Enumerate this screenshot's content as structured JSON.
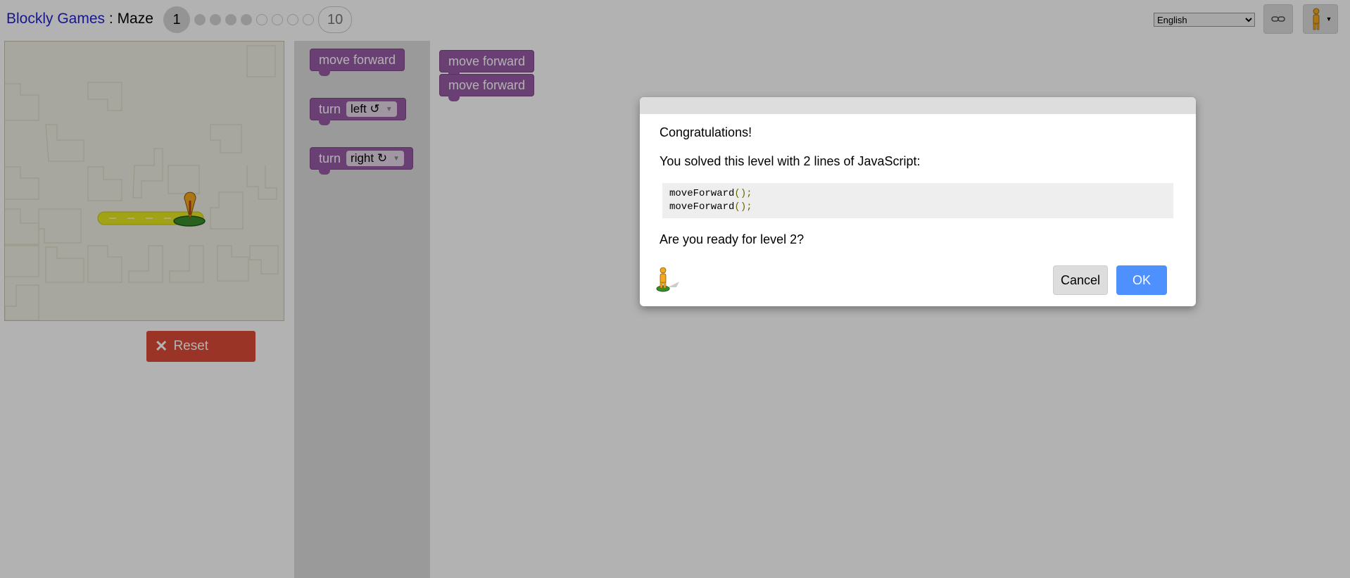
{
  "header": {
    "app_title": "Blockly Games",
    "separator": " : ",
    "game_title": "Maze",
    "current_level": "1",
    "last_level": "10",
    "levels_done": 4,
    "levels_todo": 5,
    "language": "English",
    "link_icon": "link-icon",
    "avatar_icon": "pegman-icon"
  },
  "maze": {
    "reset_label": "Reset",
    "reset_icon": "close-icon"
  },
  "toolbox": {
    "move_forward": "move forward",
    "turn_label": "turn",
    "turn_left": "left ↺",
    "turn_right": "right ↻"
  },
  "program": {
    "blocks": [
      "move forward",
      "move forward"
    ]
  },
  "dialog": {
    "heading": "Congratulations!",
    "message": "You solved this level with 2 lines of JavaScript:",
    "code_lines": [
      {
        "fn": "moveForward",
        "punc": "();"
      },
      {
        "fn": "moveForward",
        "punc": "();"
      }
    ],
    "question": "Are you ready for level 2?",
    "cancel_label": "Cancel",
    "ok_label": "OK"
  },
  "colors": {
    "block": "#995ba5",
    "reset": "#dd4b39",
    "ok": "#4d90fe",
    "link": "#2222cc"
  }
}
